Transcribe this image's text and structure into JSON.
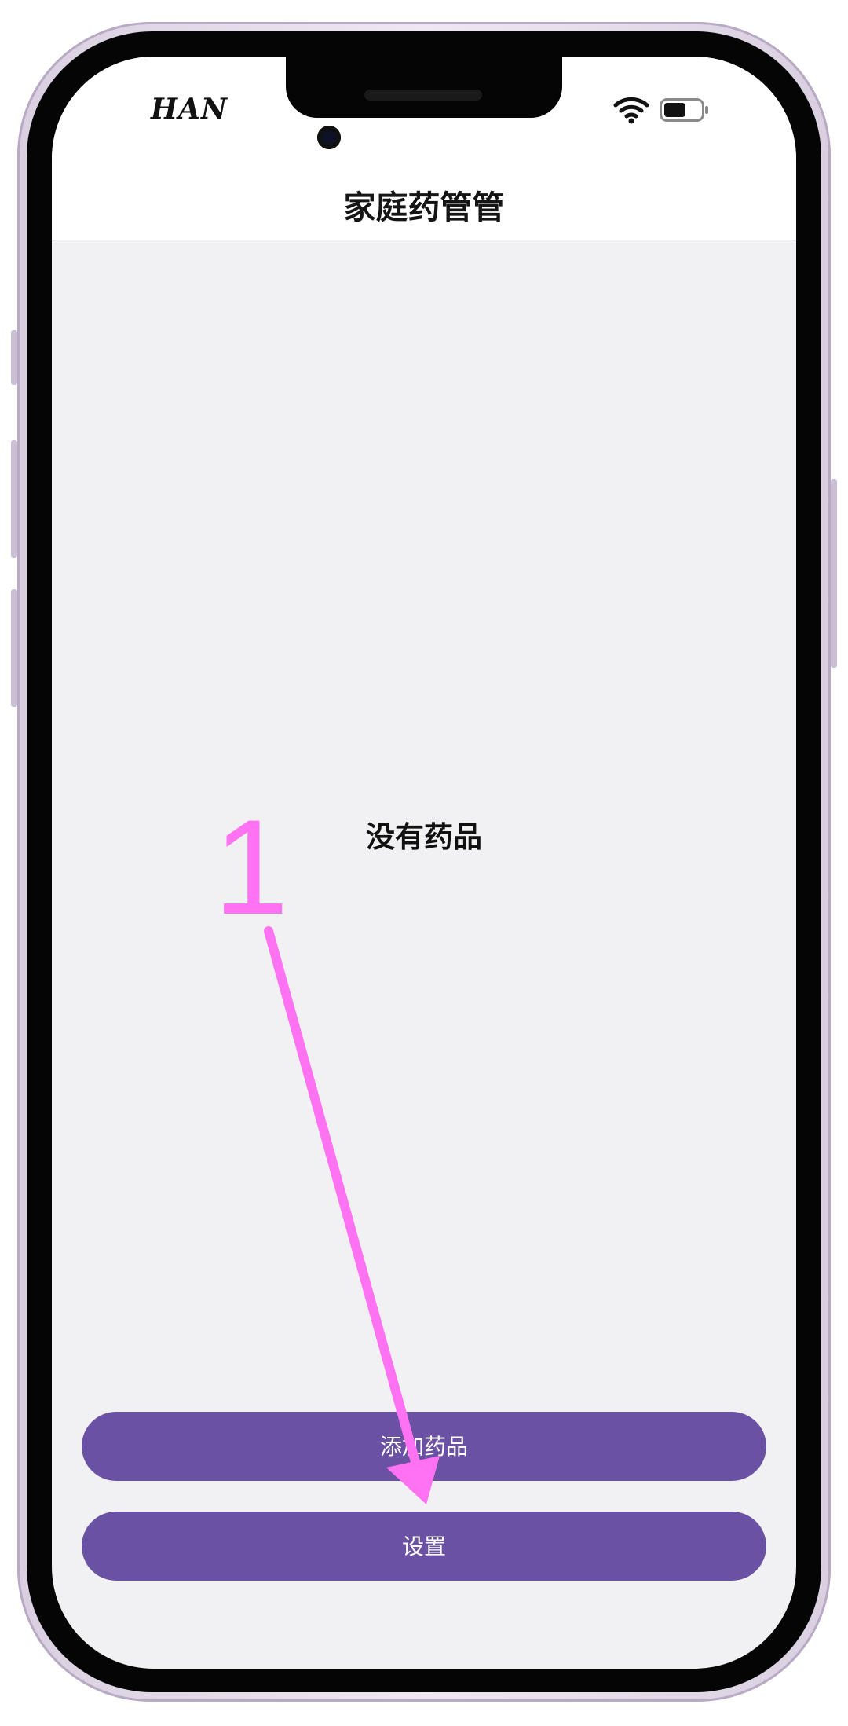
{
  "status_bar": {
    "carrier": "HAN",
    "wifi_icon": "wifi-icon",
    "battery_icon": "battery-icon",
    "battery_level_percent": 60
  },
  "header": {
    "title": "家庭药管管"
  },
  "main": {
    "empty_message": "没有药品"
  },
  "actions": {
    "add_medicine_label": "添加药品",
    "settings_label": "设置"
  },
  "annotation": {
    "step_number": "1",
    "color": "#ff73f2"
  },
  "colors": {
    "button_bg": "#6b51a3",
    "screen_bg": "#f1f0f2",
    "frame": "#d9cfe0"
  }
}
